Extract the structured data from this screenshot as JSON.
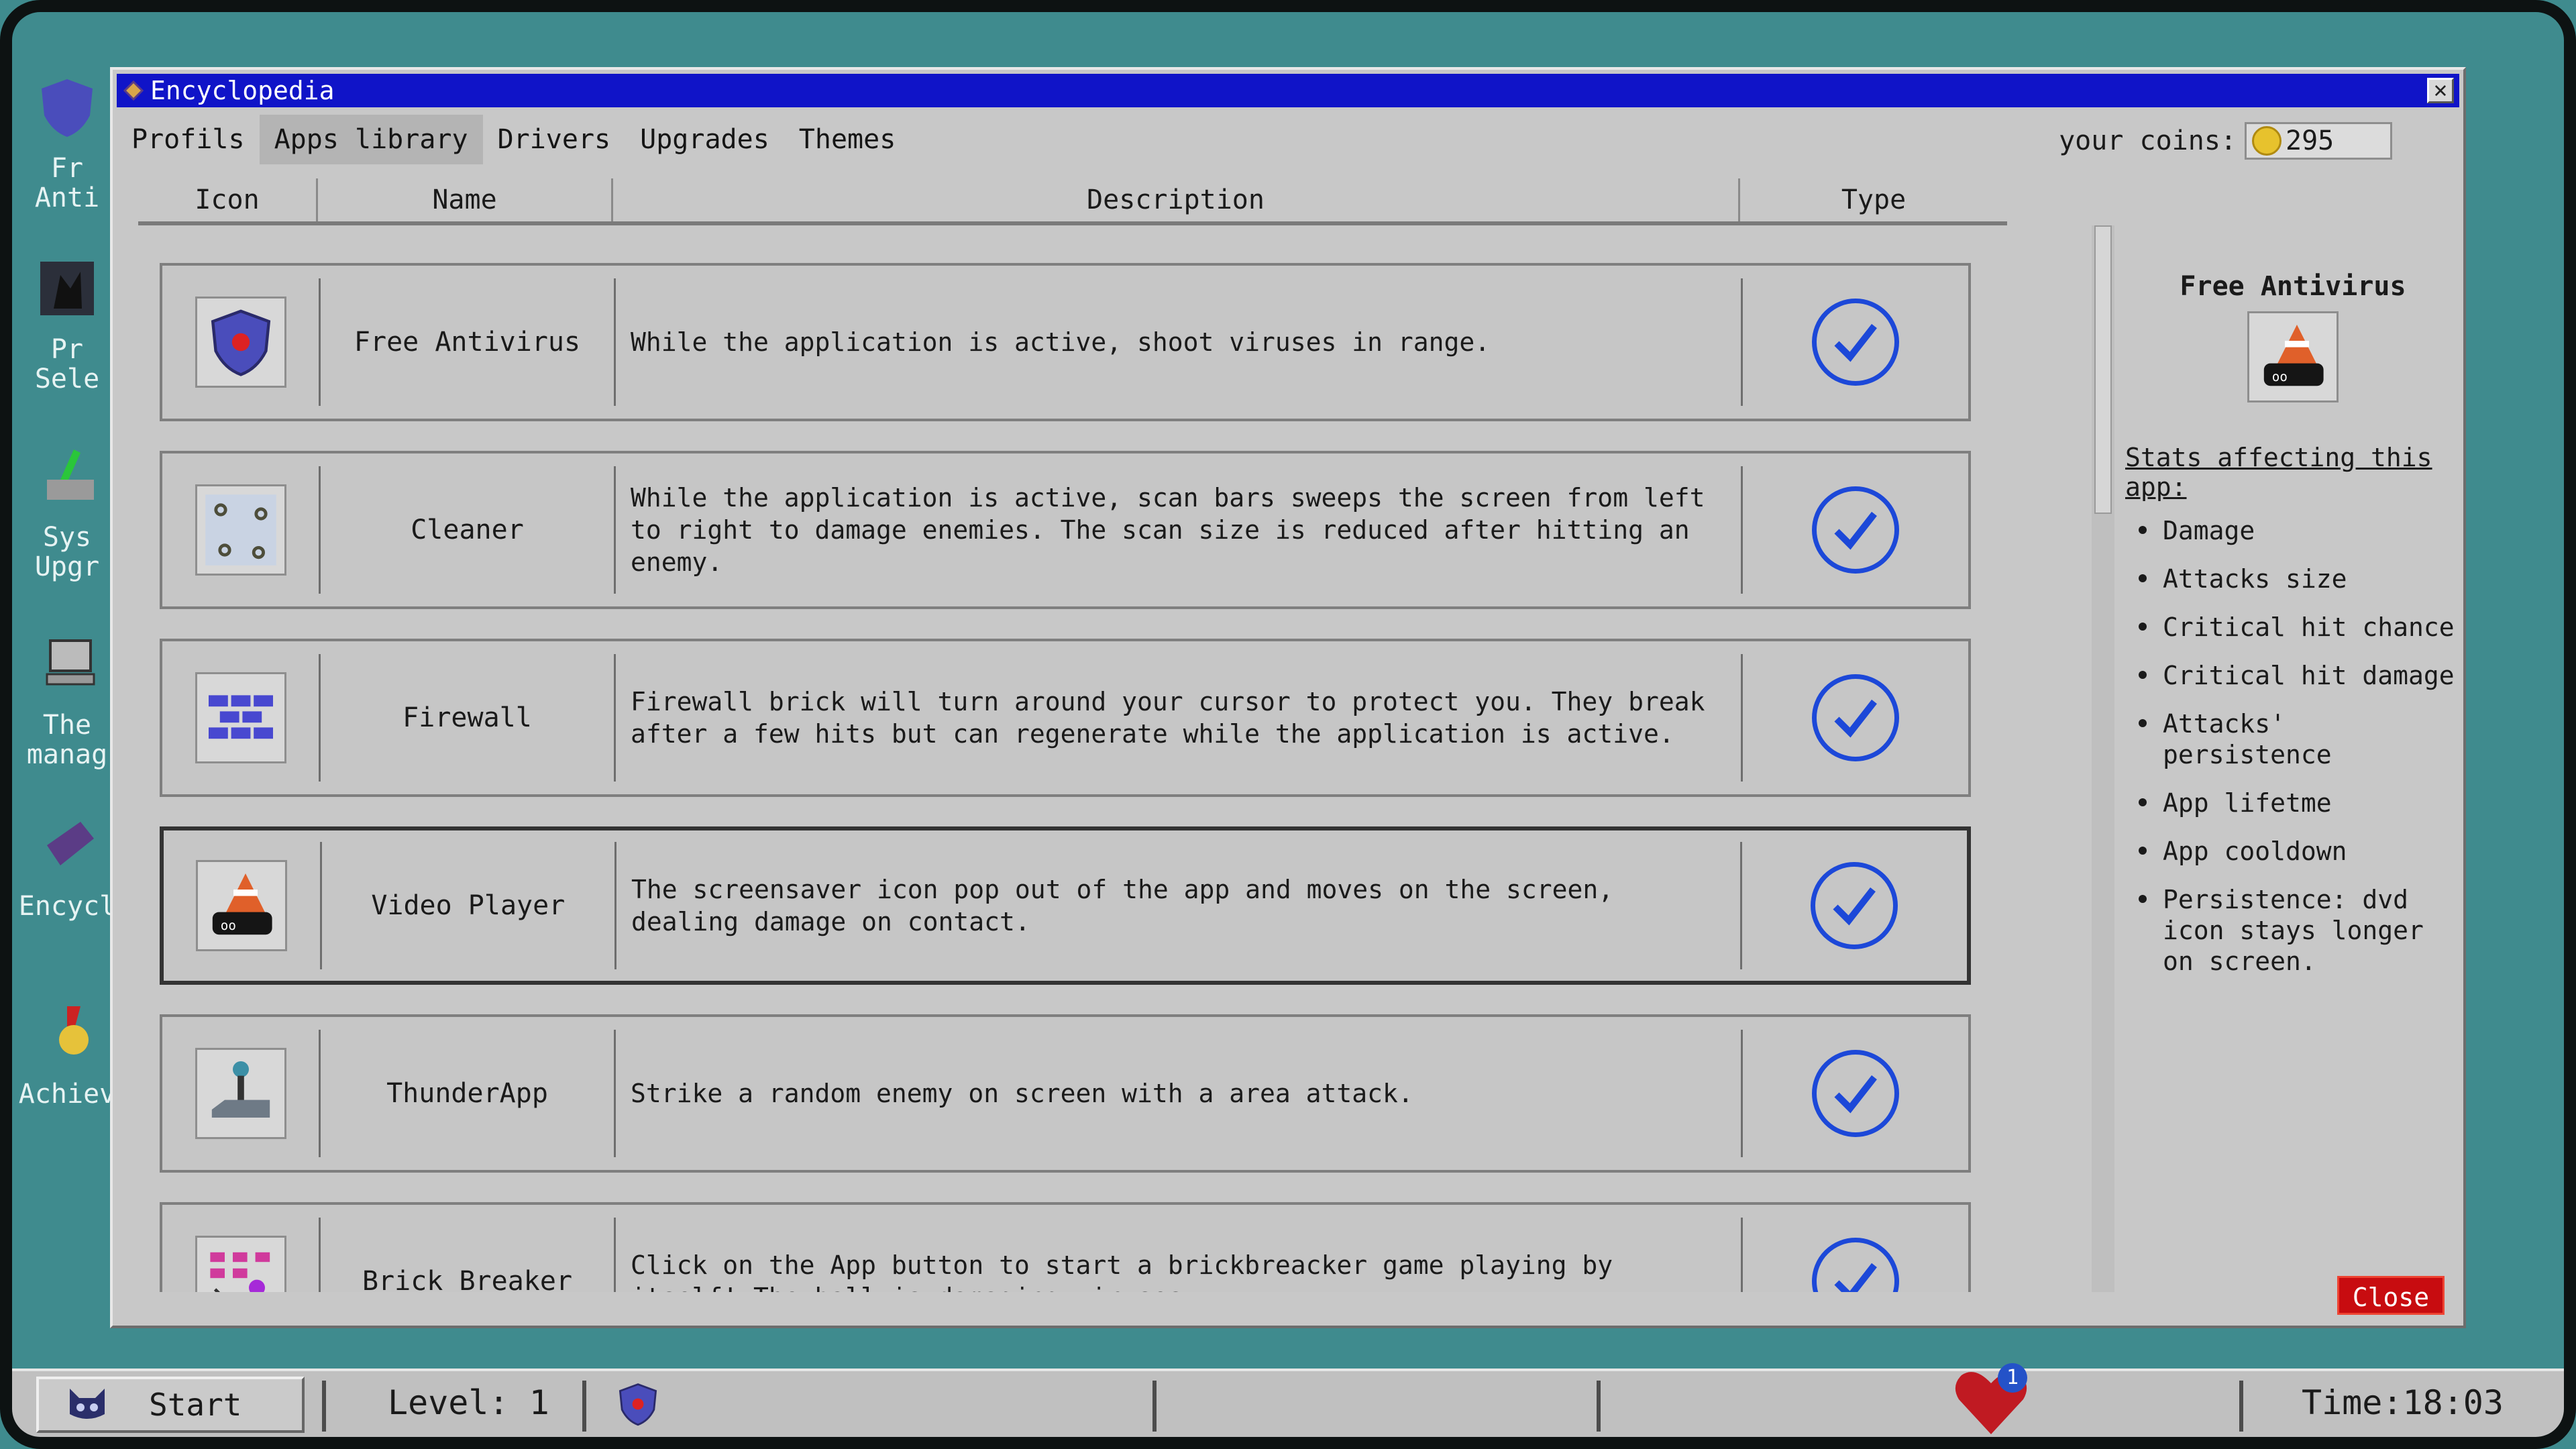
{
  "desktop": {
    "icons": [
      {
        "label": "Fr\nAnti",
        "icon": "shield-icon"
      },
      {
        "label": "Pr\nSele",
        "icon": "cat-icon"
      },
      {
        "label": "Sys\nUpgr",
        "icon": "upgrade-icon"
      },
      {
        "label": "The\nmanag",
        "icon": "computer-icon"
      },
      {
        "label": "Encycl",
        "icon": "book-icon"
      },
      {
        "label": "Achiev",
        "icon": "medal-icon"
      }
    ]
  },
  "window": {
    "title": "Encyclopedia",
    "close_glyph": "✕",
    "tabs": [
      "Profils",
      "Apps library",
      "Drivers",
      "Upgrades",
      "Themes"
    ],
    "active_tab": "Apps library",
    "coins_label": "your coins:",
    "coins_value": "295",
    "close_button": "Close"
  },
  "table": {
    "columns": [
      "Icon",
      "Name",
      "Description",
      "Type"
    ],
    "rows": [
      {
        "icon": "shield-icon",
        "name": "Free Antivirus",
        "description": "While the application is active, shoot viruses in range."
      },
      {
        "icon": "scanner-icon",
        "name": "Cleaner",
        "description": "While the application is active, scan bars sweeps the screen from left to right to damage enemies. The scan size is reduced after hitting an enemy."
      },
      {
        "icon": "brick-wall-icon",
        "name": "Firewall",
        "description": "Firewall brick will turn around your cursor to protect you. They break after a few hits but can regenerate while the application is active."
      },
      {
        "icon": "traffic-cone-icon",
        "name": "Video Player",
        "description": "The screensaver icon pop out of the app and moves on the screen, dealing damage on contact."
      },
      {
        "icon": "joystick-icon",
        "name": "ThunderApp",
        "description": "Strike a random enemy on screen with a area attack."
      },
      {
        "icon": "brick-breaker-icon",
        "name": "Brick Breaker",
        "description": "Click on the App button to start a brickbreacker game playing by itself! The ball is damaging viruses."
      }
    ]
  },
  "detail": {
    "title": "Free Antivirus",
    "icon": "traffic-cone-icon",
    "stats_heading": "Stats affecting this app:",
    "stats": [
      "Damage",
      "Attacks size",
      "Critical hit chance",
      "Critical hit damage",
      "Attacks' persistence",
      "App lifetme",
      "App cooldown",
      "Persistence: dvd icon stays longer on screen."
    ]
  },
  "taskbar": {
    "start_label": "Start",
    "level": "Level: 1",
    "notification_count": "1",
    "time": "Time:18:03"
  },
  "colors": {
    "titlebar": "#1014c8",
    "desktop": "#3f8b8e",
    "check": "#1c48d8",
    "close_button": "#c80c10"
  }
}
